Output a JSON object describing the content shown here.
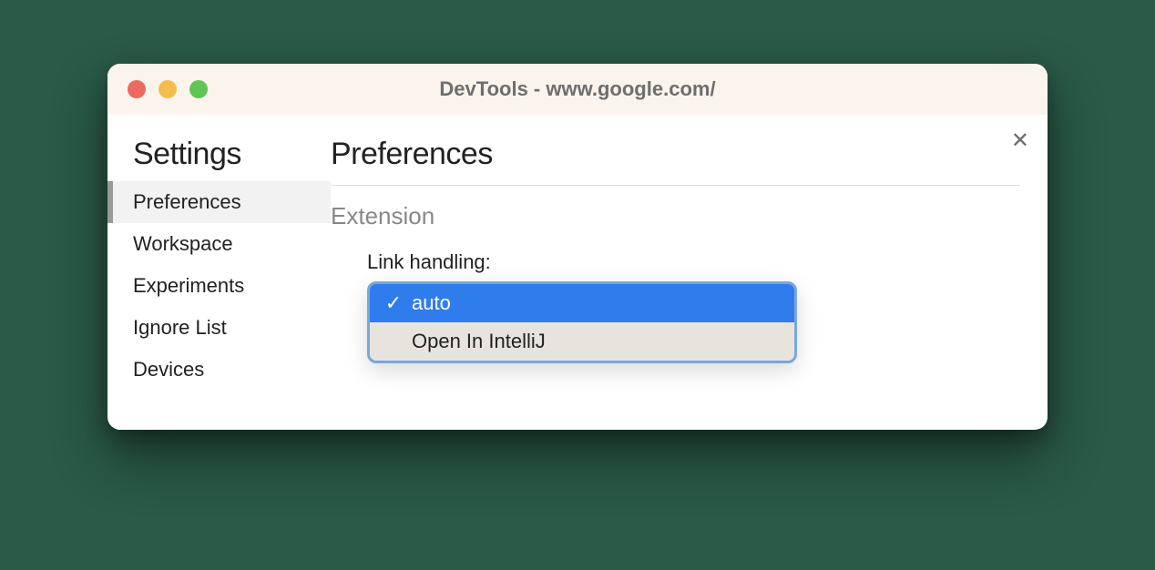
{
  "window": {
    "title": "DevTools - www.google.com/"
  },
  "close_symbol": "✕",
  "sidebar": {
    "title": "Settings",
    "items": [
      {
        "label": "Preferences",
        "active": true
      },
      {
        "label": "Workspace",
        "active": false
      },
      {
        "label": "Experiments",
        "active": false
      },
      {
        "label": "Ignore List",
        "active": false
      },
      {
        "label": "Devices",
        "active": false
      }
    ]
  },
  "main": {
    "title": "Preferences",
    "section": "Extension",
    "setting_label": "Link handling:",
    "dropdown": {
      "options": [
        {
          "label": "auto",
          "selected": true
        },
        {
          "label": "Open In IntelliJ",
          "selected": false
        }
      ],
      "check_glyph": "✓"
    }
  }
}
